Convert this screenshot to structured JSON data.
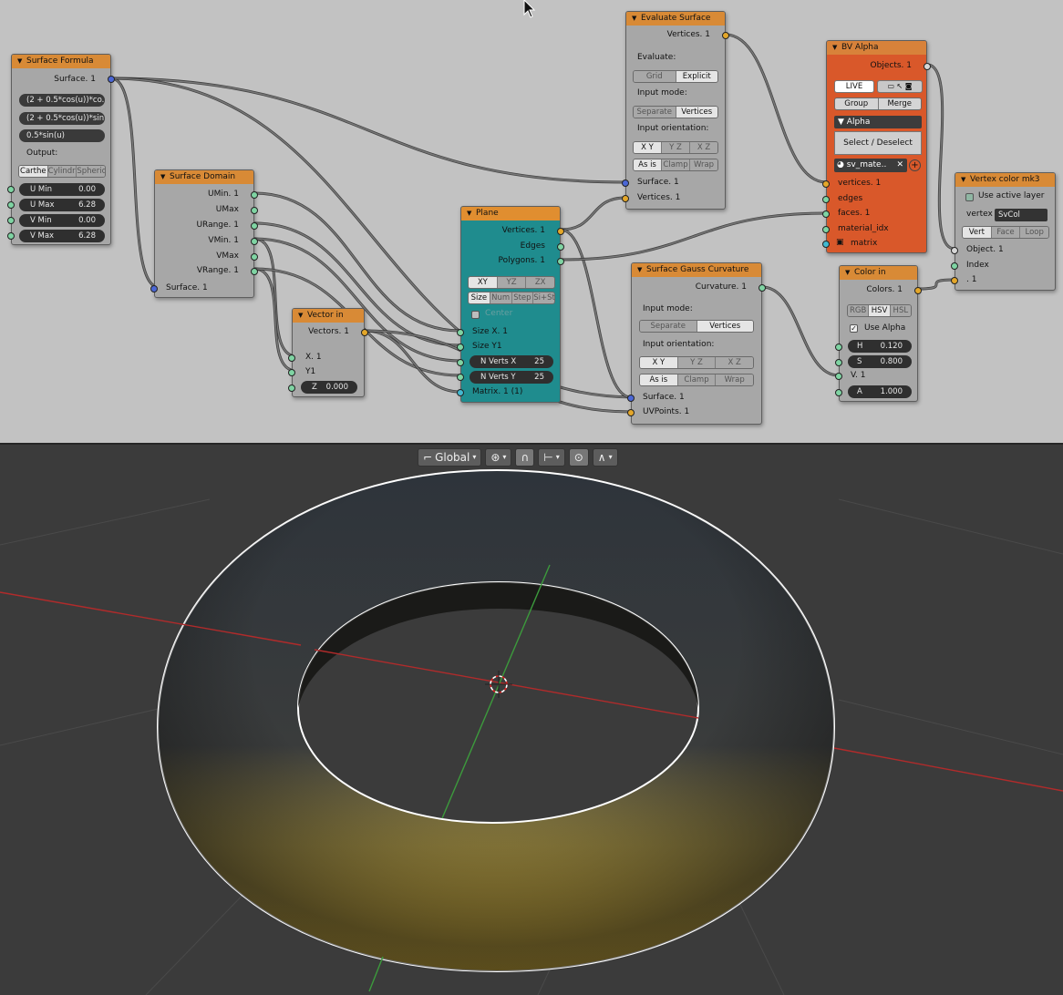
{
  "nodes": {
    "surface_formula": {
      "title": "Surface Formula",
      "out_surface": "Surface. 1",
      "formula_x": "(2 + 0.5*cos(u))*co..",
      "formula_y": "(2 + 0.5*cos(u))*sin..",
      "formula_z": "0.5*sin(u)",
      "output_label": "Output:",
      "modes": [
        "Carthe",
        "Cylindri",
        "Spheric"
      ],
      "u_min_label": "U Min",
      "u_min": "0.00",
      "u_max_label": "U Max",
      "u_max": "6.28",
      "v_min_label": "V Min",
      "v_min": "0.00",
      "v_max_label": "V Max",
      "v_max": "6.28"
    },
    "surface_domain": {
      "title": "Surface Domain",
      "outs": [
        "UMin. 1",
        "UMax",
        "URange. 1",
        "VMin. 1",
        "VMax",
        "VRange. 1"
      ],
      "in_surface": "Surface. 1"
    },
    "vector_in": {
      "title": "Vector in",
      "out_vectors": "Vectors. 1",
      "in_x": "X. 1",
      "in_y": "Y1",
      "z_label": "Z",
      "z_value": "0.000"
    },
    "plane": {
      "title": "Plane",
      "outs": [
        "Vertices. 1",
        "Edges",
        "Polygons. 1"
      ],
      "axes": [
        "XY",
        "YZ",
        "ZX"
      ],
      "modes": [
        "Size",
        "Num",
        "Step",
        "Si+St"
      ],
      "center_label": "Center",
      "in_size_x": "Size X. 1",
      "in_size_y": "Size Y1",
      "nverts_x_label": "N Verts X",
      "nverts_x": "25",
      "nverts_y_label": "N Verts Y",
      "nverts_y": "25",
      "in_matrix": "Matrix. 1 (1)"
    },
    "evaluate_surface": {
      "title": "Evaluate Surface",
      "out_vertices": "Vertices. 1",
      "evaluate_label": "Evaluate:",
      "evaluate_modes": [
        "Grid",
        "Explicit"
      ],
      "input_mode_label": "Input mode:",
      "input_modes": [
        "Separate",
        "Vertices"
      ],
      "orientation_label": "Input orientation:",
      "orientations": [
        "X Y",
        "Y Z",
        "X Z"
      ],
      "clamp_modes": [
        "As is",
        "Clamp",
        "Wrap"
      ],
      "in_surface": "Surface. 1",
      "in_vertices": "Vertices. 1"
    },
    "gauss_curvature": {
      "title": "Surface Gauss Curvature",
      "out_curvature": "Curvature. 1",
      "input_mode_label": "Input mode:",
      "input_modes": [
        "Separate",
        "Vertices"
      ],
      "orientation_label": "Input orientation:",
      "orientations": [
        "X Y",
        "Y Z",
        "X Z"
      ],
      "clamp_modes": [
        "As is",
        "Clamp",
        "Wrap"
      ],
      "in_surface": "Surface. 1",
      "in_uvpoints": "UVPoints. 1"
    },
    "bv_alpha": {
      "title": "BV Alpha",
      "out_objects": "Objects. 1",
      "live_label": "LIVE",
      "group_label": "Group",
      "merge_label": "Merge",
      "alpha_label": "Alpha",
      "select_label": "Select / Deselect",
      "material": "sv_mate..",
      "ins": [
        "vertices. 1",
        "edges",
        "faces. 1",
        "material_idx",
        "matrix"
      ]
    },
    "color_in": {
      "title": "Color in",
      "out_colors": "Colors. 1",
      "modes": [
        "RGB",
        "HSV",
        "HSL"
      ],
      "use_alpha": "Use Alpha",
      "h_label": "H",
      "h": "0.120",
      "s_label": "S",
      "s": "0.800",
      "v_label": "V. 1",
      "a_label": "A",
      "a": "1.000"
    },
    "vertex_color": {
      "title": "Vertex color mk3",
      "use_active_layer": "Use active layer",
      "vertex_label": "vertex",
      "vertex_value": "SvCol",
      "modes": [
        "Vert",
        "Face",
        "Loop"
      ],
      "ins": [
        "Object. 1",
        "Index",
        ". 1"
      ]
    }
  },
  "viewport": {
    "orientation_label": "Global",
    "icons": [
      "transform-orientation-icon",
      "pivot-icon",
      "snap-magnet-icon",
      "snap-element-icon",
      "proportional-edit-icon",
      "falloff-icon"
    ],
    "colors": {
      "torus_top": "#2e343b",
      "torus_bottom": "#c8a52e",
      "x_axis": "#b12b2b",
      "y_axis": "#3c9a3c",
      "grid": "#4a4a4a"
    }
  }
}
